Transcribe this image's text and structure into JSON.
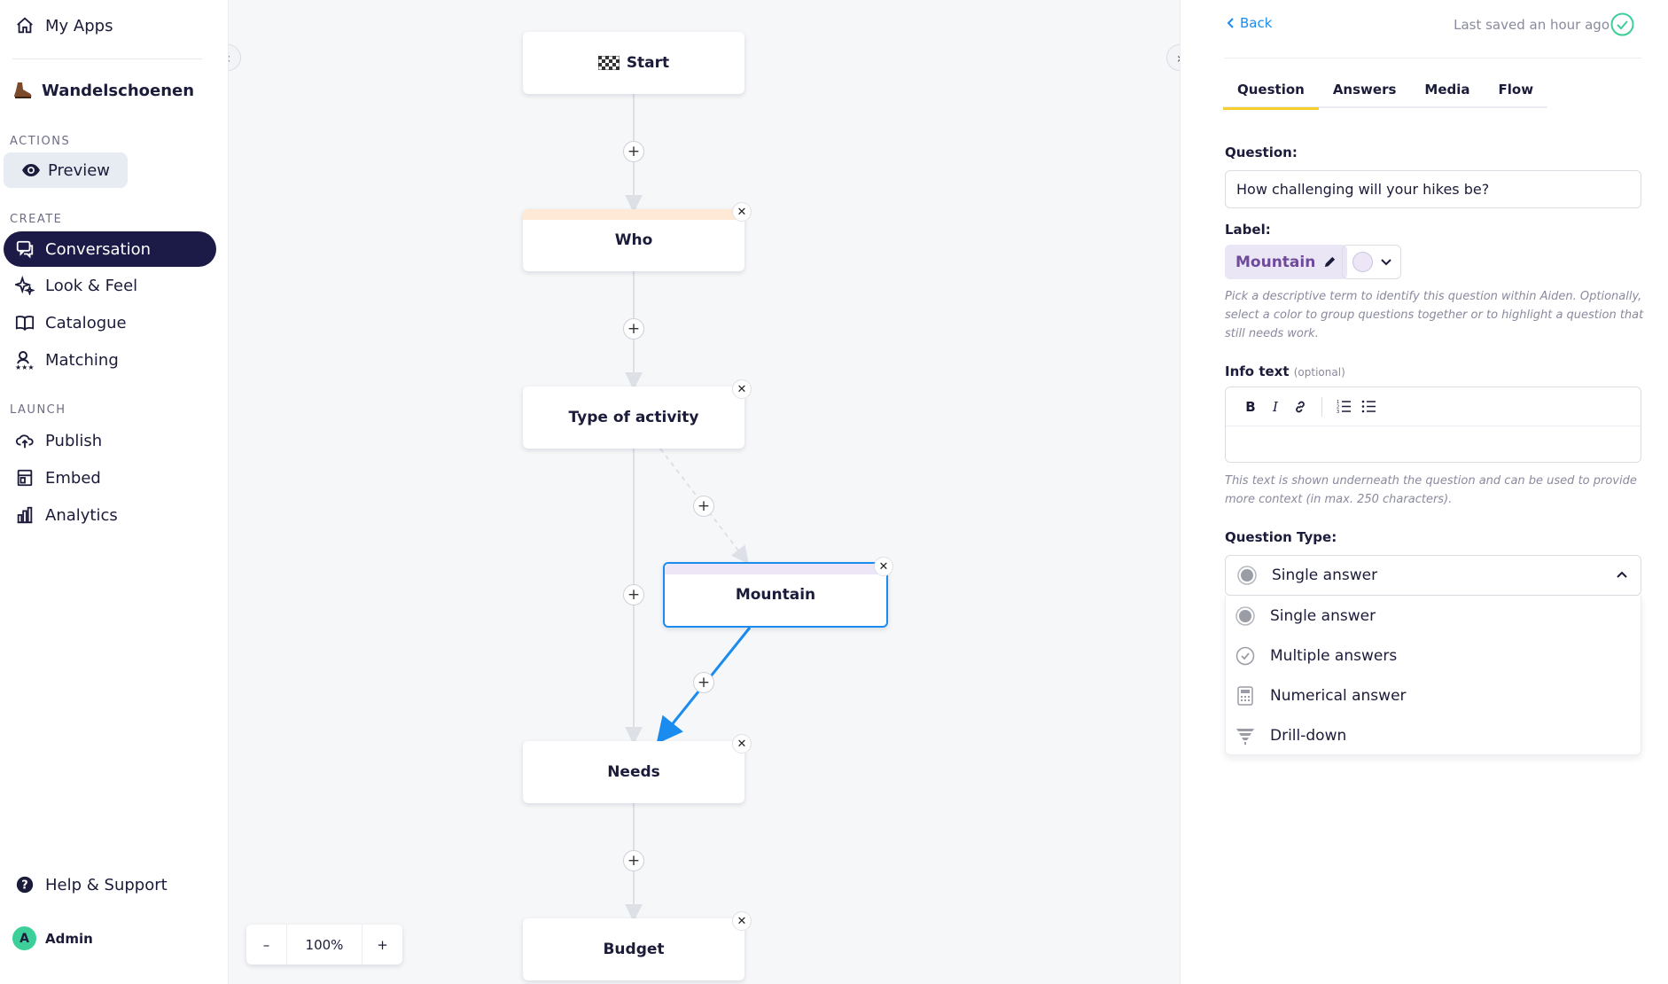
{
  "sidebar": {
    "my_apps": "My Apps",
    "project_name": "Wandelschoenen",
    "sections": {
      "actions": "ACTIONS",
      "create": "CREATE",
      "launch": "LAUNCH"
    },
    "preview": "Preview",
    "items": [
      {
        "label": "Conversation",
        "icon": "chat-icon",
        "active": true
      },
      {
        "label": "Look & Feel",
        "icon": "sparkle-icon"
      },
      {
        "label": "Catalogue",
        "icon": "book-icon"
      },
      {
        "label": "Matching",
        "icon": "matching-icon"
      },
      {
        "label": "Publish",
        "icon": "upload-cloud-icon"
      },
      {
        "label": "Embed",
        "icon": "embed-icon"
      },
      {
        "label": "Analytics",
        "icon": "bar-chart-icon"
      }
    ],
    "help": "Help & Support",
    "user": {
      "initial": "A",
      "name": "Admin"
    }
  },
  "canvas": {
    "nodes": [
      {
        "label": "Start",
        "icon": "checkered-flag-icon"
      },
      {
        "label": "Who",
        "stripe": "#fde9d6"
      },
      {
        "label": "Type of activity"
      },
      {
        "label": "Mountain",
        "stripe": "#ece6f7",
        "selected": true
      },
      {
        "label": "Needs"
      },
      {
        "label": "Budget"
      }
    ],
    "zoom": {
      "minus": "–",
      "value": "100%",
      "plus": "+"
    }
  },
  "panel": {
    "back": "Back",
    "saved": "Last saved an hour ago",
    "tabs": [
      "Question",
      "Answers",
      "Media",
      "Flow"
    ],
    "active_tab": "Question",
    "question_label": "Question:",
    "question_value": "How challenging will your hikes be?",
    "label_label": "Label:",
    "label_value": "Mountain",
    "label_help": "Pick a descriptive term to identify this question within Aiden. Optionally, select a color to group questions together or to highlight a question that still needs work.",
    "info_label": "Info text",
    "info_optional": "(optional)",
    "info_help": "This text is shown underneath the question and can be used to provide more context (in max. 250 characters).",
    "type_label": "Question Type:",
    "type_selected": "Single answer",
    "type_options": [
      {
        "label": "Single answer",
        "icon": "radio-filled-icon"
      },
      {
        "label": "Multiple answers",
        "icon": "check-circle-icon"
      },
      {
        "label": "Numerical answer",
        "icon": "calculator-icon"
      },
      {
        "label": "Drill-down",
        "icon": "funnel-icon"
      }
    ],
    "colors": {
      "accent": "#1a8cef",
      "tab_underline": "#f5cf2b",
      "saved_check": "#3ccf9a",
      "label_chip": "#ebe6f5"
    }
  }
}
